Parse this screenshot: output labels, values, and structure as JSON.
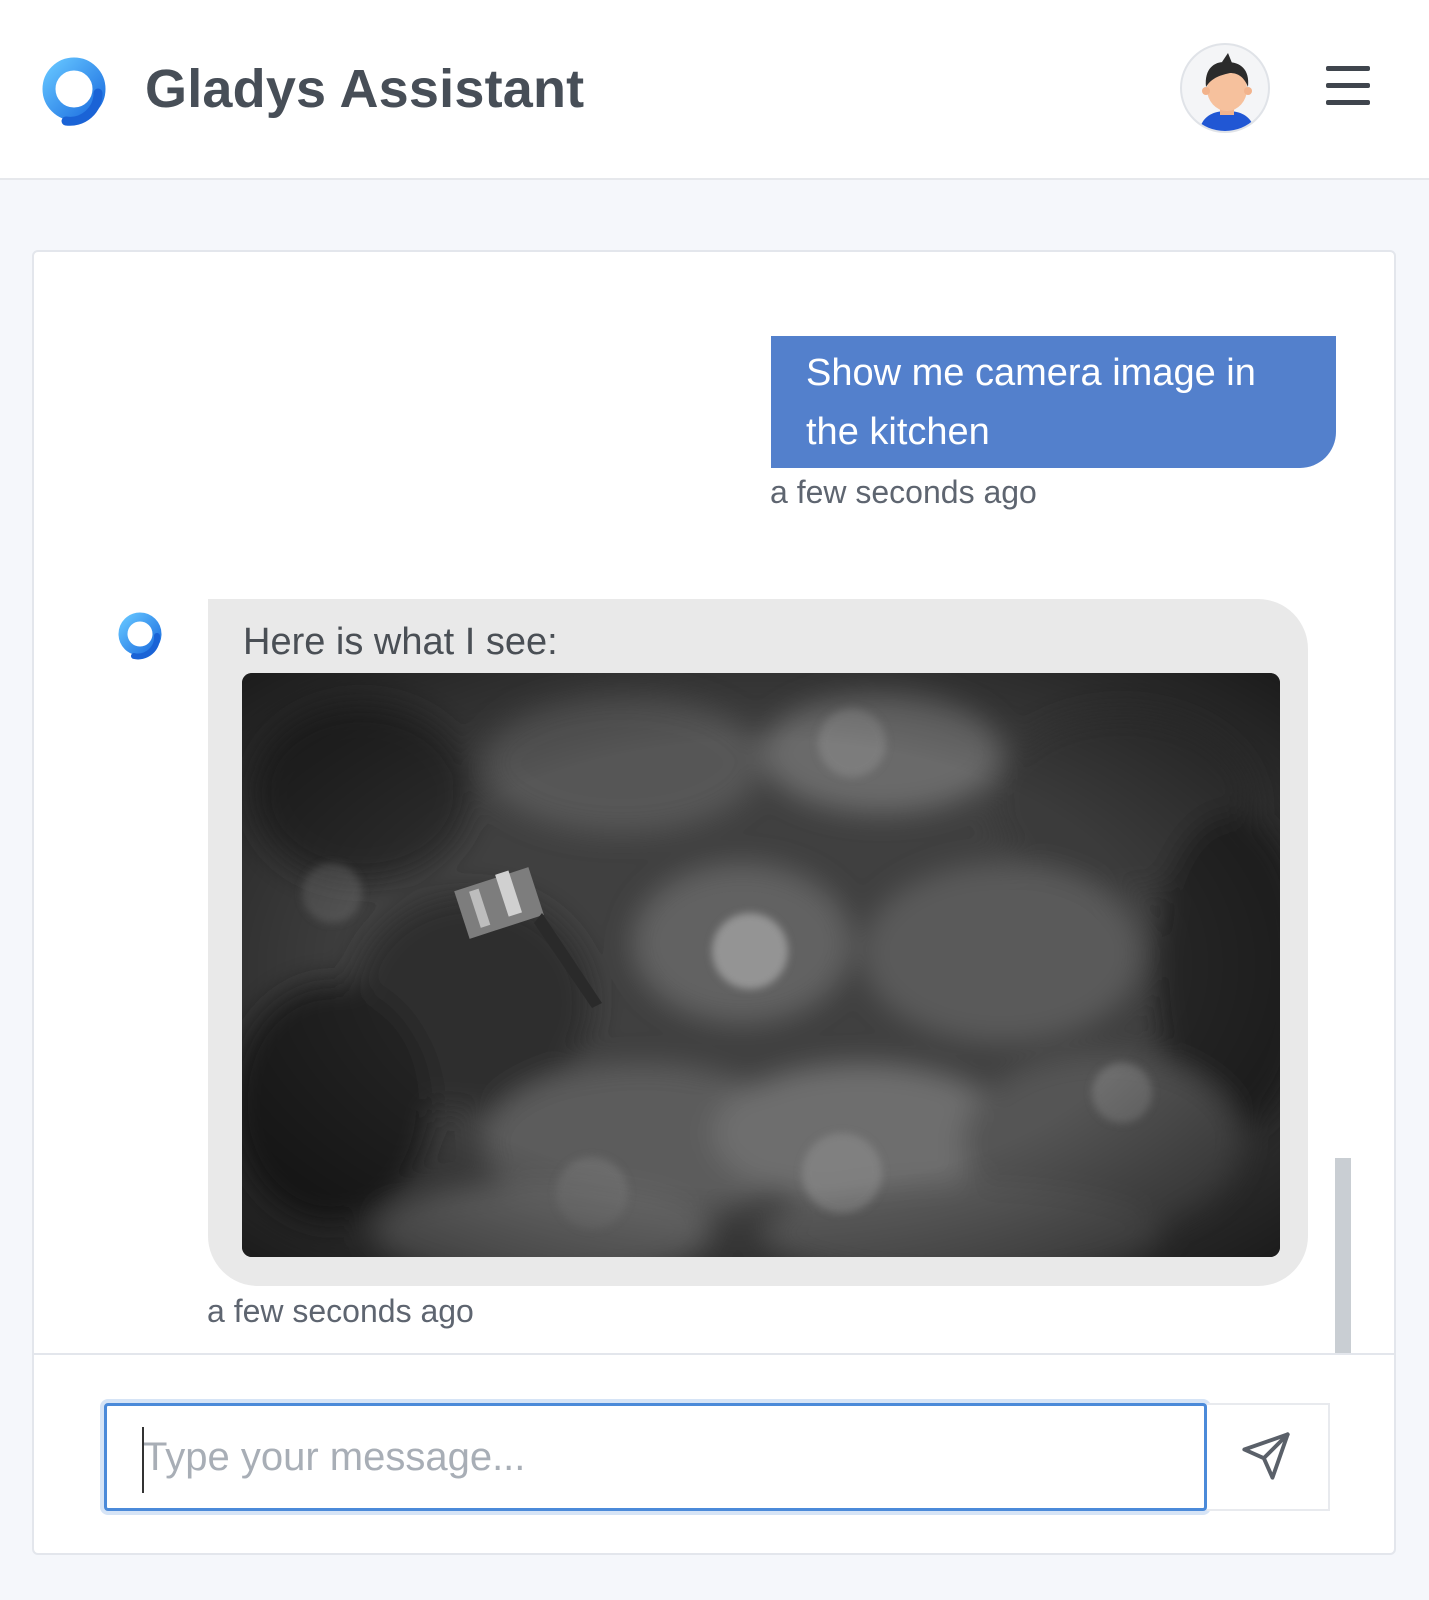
{
  "header": {
    "brand": "Gladys Assistant",
    "logo_icon": "gladys-logo-icon",
    "avatar_icon": "user-avatar-icon",
    "menu_icon": "hamburger-menu-icon"
  },
  "chat": {
    "messages": [
      {
        "sender": "user",
        "text": "Show me camera image in the kitchen",
        "time": "a few seconds ago"
      },
      {
        "sender": "assistant",
        "text": "Here is what I see:",
        "attachment": "camera-image",
        "time": "a few seconds ago"
      }
    ]
  },
  "composer": {
    "placeholder": "Type your message...",
    "value": "",
    "send_icon": "send-icon"
  },
  "colors": {
    "accent": "#5380cc",
    "logo": "#2f8bea",
    "focus_border": "#4b8ad9"
  }
}
